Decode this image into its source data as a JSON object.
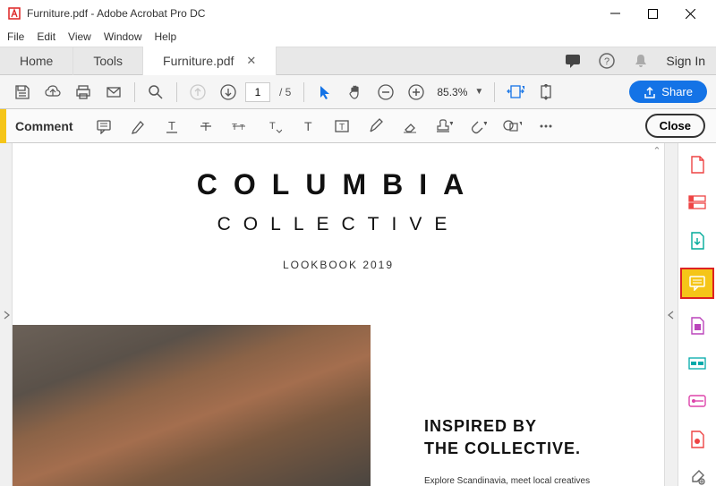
{
  "titlebar": {
    "filename": "Furniture.pdf",
    "appname": "Adobe Acrobat Pro DC"
  },
  "menu": {
    "file": "File",
    "edit": "Edit",
    "view": "View",
    "window": "Window",
    "help": "Help"
  },
  "tabs": {
    "home": "Home",
    "tools": "Tools",
    "doc": "Furniture.pdf",
    "signin": "Sign In"
  },
  "toolbar": {
    "page_current": "1",
    "page_total": "/  5",
    "zoom": "85.3%",
    "share": "Share"
  },
  "commentbar": {
    "label": "Comment",
    "close": "Close"
  },
  "document": {
    "title1": "COLUMBIA",
    "title2": "COLLECTIVE",
    "subtitle": "LOOKBOOK 2019",
    "heading1": "INSPIRED BY",
    "heading2": "THE COLLECTIVE.",
    "body": "Explore Scandinavia, meet local creatives"
  }
}
